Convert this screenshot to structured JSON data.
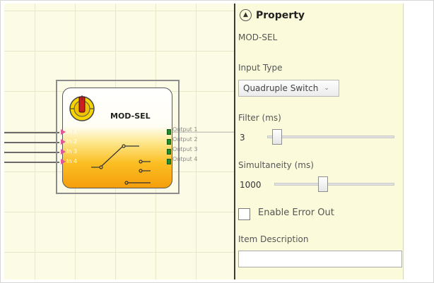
{
  "block": {
    "title": "MOD-SEL",
    "inputs": [
      "In 1",
      "In 2",
      "In 3",
      "In 4"
    ],
    "outputs": [
      "Output 1",
      "Output 2",
      "Output 3",
      "Output 4"
    ]
  },
  "property": {
    "title": "Property",
    "block_name": "MOD-SEL",
    "input_type_label": "Input Type",
    "input_type_value": "Quadruple Switch",
    "filter_label": "Filter (ms)",
    "filter_value": "3",
    "simultaneity_label": "Simultaneity (ms)",
    "simultaneity_value": "1000",
    "enable_error_out_label": "Enable Error Out",
    "enable_error_out_checked": false,
    "item_description_label": "Item Description",
    "item_description_value": ""
  },
  "colors": {
    "canvas_bg": "#fbfbe6",
    "panel_bg": "#fbfbdc",
    "input_port": "#e0589a",
    "output_port": "#1f8f2a",
    "block_gradient_bottom": "#f59e0b"
  }
}
